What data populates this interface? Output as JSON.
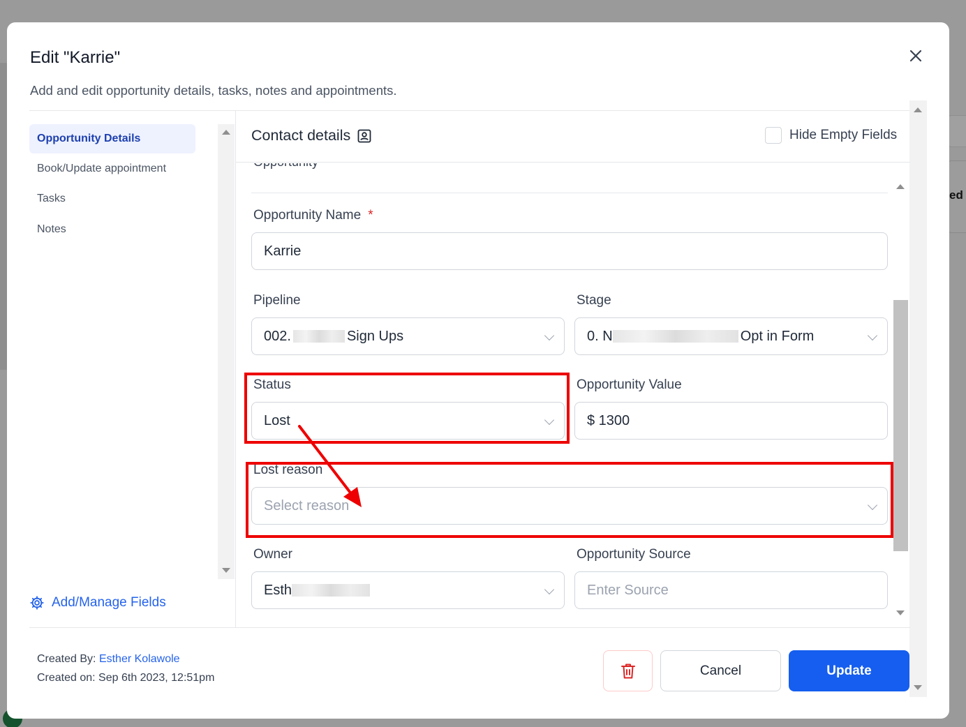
{
  "modal": {
    "title": "Edit \"Karrie\"",
    "subtitle": "Add and edit opportunity details, tasks, notes and appointments."
  },
  "sidebar": {
    "items": [
      {
        "label": "Opportunity Details",
        "active": true
      },
      {
        "label": "Book/Update appointment",
        "active": false
      },
      {
        "label": "Tasks",
        "active": false
      },
      {
        "label": "Notes",
        "active": false
      }
    ],
    "manage_fields": "Add/Manage Fields"
  },
  "content": {
    "section_title": "Contact details",
    "hide_empty_label": "Hide Empty Fields",
    "hide_empty_checked": false,
    "clipped_heading": "Opportunity"
  },
  "form": {
    "opportunity_name": {
      "label": "Opportunity Name",
      "required_mark": "*",
      "value": "Karrie"
    },
    "pipeline": {
      "label": "Pipeline",
      "value_start": "002.",
      "value_end": "Sign Ups"
    },
    "stage": {
      "label": "Stage",
      "value_start": "0. N",
      "value_end": "Opt in Form"
    },
    "status": {
      "label": "Status",
      "value": "Lost"
    },
    "opportunity_value": {
      "label": "Opportunity Value",
      "value": "$ 1300"
    },
    "lost_reason": {
      "label": "Lost reason",
      "placeholder": "Select reason"
    },
    "owner": {
      "label": "Owner",
      "value_start": "Esth"
    },
    "opportunity_source": {
      "label": "Opportunity Source",
      "placeholder": "Enter Source"
    }
  },
  "footer": {
    "created_by_label": "Created By:",
    "created_by_name": "Esther Kolawole",
    "created_on": "Created on: Sep 6th 2023, 12:51pm",
    "cancel_label": "Cancel",
    "update_label": "Update"
  },
  "background": {
    "peek_text": "ed"
  },
  "colors": {
    "primary": "#155eef",
    "annotation": "#ee0000",
    "active_nav_bg": "#eef2ff",
    "active_nav_text": "#1e40af",
    "delete_icon": "#dc2626"
  }
}
